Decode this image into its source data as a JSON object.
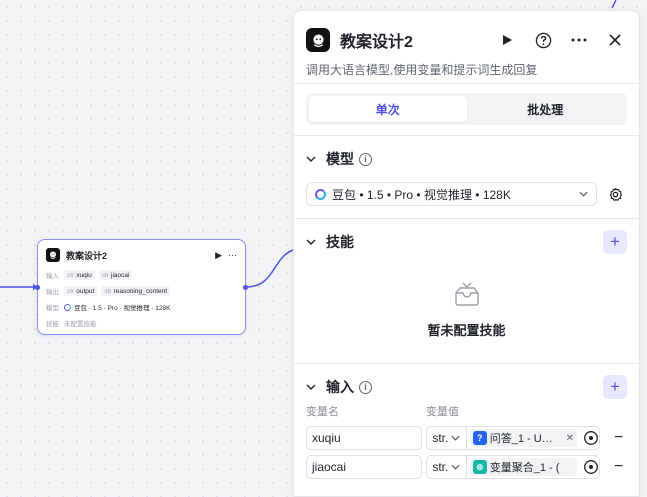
{
  "node": {
    "title": "教案设计2",
    "run_icon": "▶",
    "more_icon": "···",
    "input_label": "输入",
    "inputs": [
      "xuqiu",
      "jiaocai"
    ],
    "output_label": "输出",
    "outputs": [
      "output",
      "reasoning_content"
    ],
    "model_label": "模型",
    "model": "豆包 · 1.5 · Pro · 视觉推理 · 128K",
    "skill_label": "技能",
    "skill_value": "未配置技能",
    "type_tag": "str"
  },
  "panel": {
    "title": "教案设计2",
    "description": "调用大语言模型,使用变量和提示词生成回复",
    "tabs": [
      {
        "label": "单次",
        "active": true
      },
      {
        "label": "批处理",
        "active": false
      }
    ],
    "model_section": {
      "title": "模型",
      "selected": "豆包 • 1.5 • Pro • 视觉推理 • 128K"
    },
    "skill_section": {
      "title": "技能",
      "empty_text": "暂未配置技能"
    },
    "input_section": {
      "title": "输入",
      "col_name": "变量名",
      "col_value": "变量值",
      "rows": [
        {
          "name": "xuqiu",
          "type": "str.",
          "ref": "问答_1 - U…",
          "icon": "?",
          "icon_color": "#2563eb"
        },
        {
          "name": "jiaocai",
          "type": "str.",
          "ref": "变量聚合_1 - (",
          "icon": "⊗",
          "icon_color": "#14b8a6"
        }
      ]
    }
  },
  "colors": {
    "accent": "#4d53e8",
    "node_border": "#8b8ff0"
  }
}
